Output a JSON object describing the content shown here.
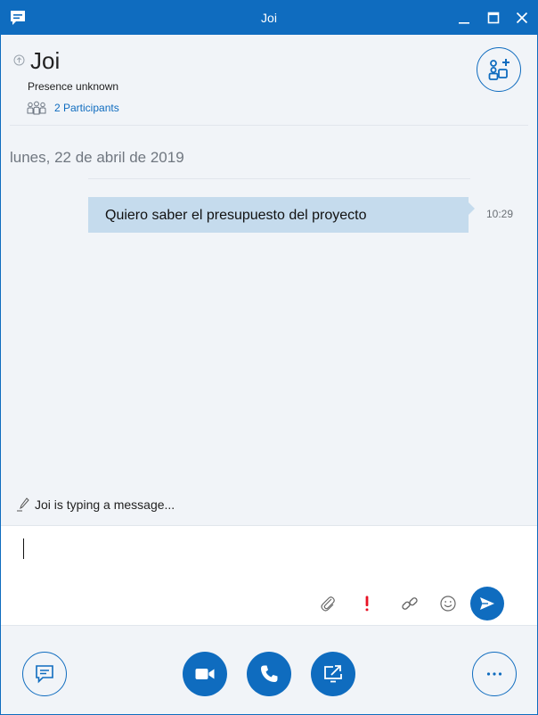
{
  "window": {
    "title": "Joi"
  },
  "header": {
    "contact_name": "Joi",
    "presence": "Presence unknown",
    "participants_label": "2 Participants"
  },
  "conversation": {
    "date": "lunes, 22 de abril de 2019",
    "messages": [
      {
        "text": "Quiero saber el presupuesto del proyecto",
        "time": "10:29"
      }
    ]
  },
  "typing_indicator": "Joi is typing a message...",
  "compose": {
    "value": ""
  },
  "colors": {
    "accent": "#0f6cbf",
    "bubble": "#c5dbed",
    "background": "#f1f4f8",
    "important": "#e81123"
  },
  "icons": {
    "app": "chat-bubble-icon",
    "add_people": "add-people-icon",
    "participants": "people-icon",
    "attach": "paperclip-icon",
    "important": "exclamation-icon",
    "link": "link-icon",
    "emoji": "smiley-icon",
    "send": "send-icon",
    "im": "instant-message-icon",
    "video": "video-camera-icon",
    "call": "phone-icon",
    "share": "share-screen-icon",
    "more": "more-options-icon"
  }
}
